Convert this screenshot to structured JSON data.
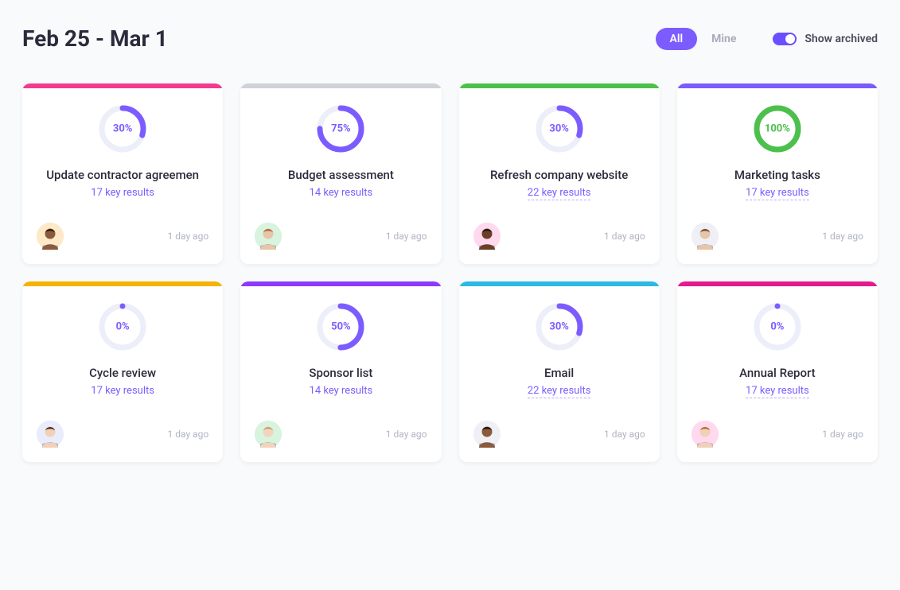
{
  "date_range": "Feb 25 - Mar 1",
  "filters": {
    "all_label": "All",
    "mine_label": "Mine",
    "active": "all"
  },
  "toggle": {
    "label": "Show archived",
    "on": true
  },
  "colors": {
    "accent": "#7c5cff",
    "ring_track": "#eceefa",
    "stripes": {
      "pink": "#f23a8f",
      "gray": "#d0d2da",
      "green": "#4cc04c",
      "violet": "#7a5bff",
      "amber": "#f5b300",
      "purple": "#8b3bff",
      "cyan": "#2bb9e6",
      "magenta": "#e61a8c"
    }
  },
  "cards": [
    {
      "stripe": "pink",
      "progress": 30,
      "progress_label": "30%",
      "ring_color": "#7c5cff",
      "title": "Update contractor agreemen",
      "sub": "17 key results",
      "sub_underline": false,
      "avatar_bg": "#fde9c7",
      "avatar_skin": "#8a5a3a",
      "avatar_hair": "#2a1a12",
      "timestamp": "1 day ago"
    },
    {
      "stripe": "gray",
      "progress": 75,
      "progress_label": "75%",
      "ring_color": "#7c5cff",
      "title": "Budget assessment",
      "sub": "14 key results",
      "sub_underline": false,
      "avatar_bg": "#d8f3de",
      "avatar_skin": "#e8c4a8",
      "avatar_hair": "#a86838",
      "timestamp": "1 day ago"
    },
    {
      "stripe": "green",
      "progress": 30,
      "progress_label": "30%",
      "ring_color": "#7c5cff",
      "title": "Refresh company website",
      "sub": "22 key results",
      "sub_underline": true,
      "avatar_bg": "#ffd9ed",
      "avatar_skin": "#6a3f28",
      "avatar_hair": "#1f1410",
      "timestamp": "1 day ago"
    },
    {
      "stripe": "violet",
      "progress": 100,
      "progress_label": "100%",
      "ring_color": "#4cc04c",
      "title": "Marketing tasks",
      "sub": "17 key results",
      "sub_underline": true,
      "avatar_bg": "#eef0f6",
      "avatar_skin": "#e8c4a8",
      "avatar_hair": "#6a4a30",
      "timestamp": "1 day ago"
    },
    {
      "stripe": "amber",
      "progress": 0,
      "progress_label": "0%",
      "ring_color": "#7c5cff",
      "title": "Cycle review",
      "sub": "17 key results",
      "sub_underline": false,
      "avatar_bg": "#e8ecfb",
      "avatar_skin": "#f2d0b8",
      "avatar_hair": "#4a2a1a",
      "timestamp": "1 day ago"
    },
    {
      "stripe": "purple",
      "progress": 50,
      "progress_label": "50%",
      "ring_color": "#7c5cff",
      "title": "Sponsor list",
      "sub": "14 key results",
      "sub_underline": false,
      "avatar_bg": "#d8f3de",
      "avatar_skin": "#f0d4be",
      "avatar_hair": "#c4a070",
      "timestamp": "1 day ago"
    },
    {
      "stripe": "cyan",
      "progress": 30,
      "progress_label": "30%",
      "ring_color": "#7c5cff",
      "title": "Email",
      "sub": "22 key results",
      "sub_underline": true,
      "avatar_bg": "#eef0f6",
      "avatar_skin": "#8a5a3a",
      "avatar_hair": "#1a1410",
      "timestamp": "1 day ago"
    },
    {
      "stripe": "magenta",
      "progress": 0,
      "progress_label": "0%",
      "ring_color": "#7c5cff",
      "title": "Annual Report",
      "sub": "17 key results",
      "sub_underline": true,
      "avatar_bg": "#ffd9ed",
      "avatar_skin": "#f0d0b8",
      "avatar_hair": "#b46a2a",
      "timestamp": "1 day ago"
    }
  ]
}
